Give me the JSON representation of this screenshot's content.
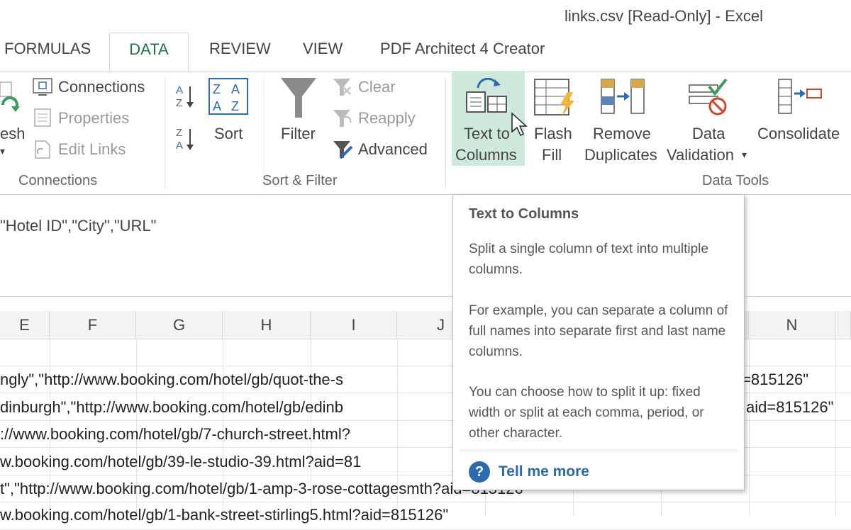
{
  "window": {
    "title": "links.csv  [Read-Only] - Excel"
  },
  "tabs": [
    {
      "label": "FORMULAS"
    },
    {
      "label": "DATA",
      "active": true
    },
    {
      "label": "REVIEW"
    },
    {
      "label": "VIEW"
    },
    {
      "label": "PDF Architect 4 Creator"
    }
  ],
  "ribbon": {
    "connections_group": {
      "refresh_label": "esh",
      "connections": "Connections",
      "properties": "Properties",
      "edit_links": "Edit Links",
      "label": "Connections"
    },
    "sort_filter_group": {
      "sort_az": "A↓Z",
      "sort_za": "Z↓A",
      "sort": "Sort",
      "filter": "Filter",
      "clear": "Clear",
      "reapply": "Reapply",
      "advanced": "Advanced",
      "label": "Sort & Filter"
    },
    "data_tools_group": {
      "text_to_columns_line1": "Text to",
      "text_to_columns_line2": "Columns",
      "flash_fill_line1": "Flash",
      "flash_fill_line2": "Fill",
      "remove_duplicates_line1": "Remove",
      "remove_duplicates_line2": "Duplicates",
      "data_validation_line1": "Data",
      "data_validation_line2": "Validation",
      "consolidate": "Consolidate",
      "label": "Data Tools"
    }
  },
  "formula_bar": {
    "value": "\"Hotel ID\",\"City\",\"URL\""
  },
  "columns": [
    "E",
    "F",
    "G",
    "H",
    "I",
    "J",
    "N"
  ],
  "rows": [
    {
      "left_text": "ngly\",\"http://www.booking.com/hotel/gb/quot-the-s",
      "right_text": "=815126\""
    },
    {
      "left_text": "dinburgh\",\"http://www.booking.com/hotel/gb/edinb",
      "right_text": "aid=815126\""
    },
    {
      "left_text": "://www.booking.com/hotel/gb/7-church-street.html?",
      "right_text": ""
    },
    {
      "left_text": "w.booking.com/hotel/gb/39-le-studio-39.html?aid=81",
      "right_text": ""
    },
    {
      "left_text": "t\",\"http://www.booking.com/hotel/gb/1-amp-3-rose-cottagesmth?aid=815126\"",
      "right_text": ""
    },
    {
      "left_text": "w.booking.com/hotel/gb/1-bank-street-stirling5.html?aid=815126\"",
      "right_text": ""
    }
  ],
  "tooltip": {
    "title": "Text to Columns",
    "paragraph1": "Split a single column of text into multiple columns.",
    "paragraph2": "For example, you can separate a column of full names into separate first and last name columns.",
    "paragraph3": "You can choose how to split it up: fixed width or split at each comma, period, or other character.",
    "help_icon": "?",
    "link": "Tell me more"
  },
  "colors": {
    "accent_green": "#217346",
    "link_blue": "#2b6cb0",
    "hover_highlight": "#cfe8dc"
  }
}
